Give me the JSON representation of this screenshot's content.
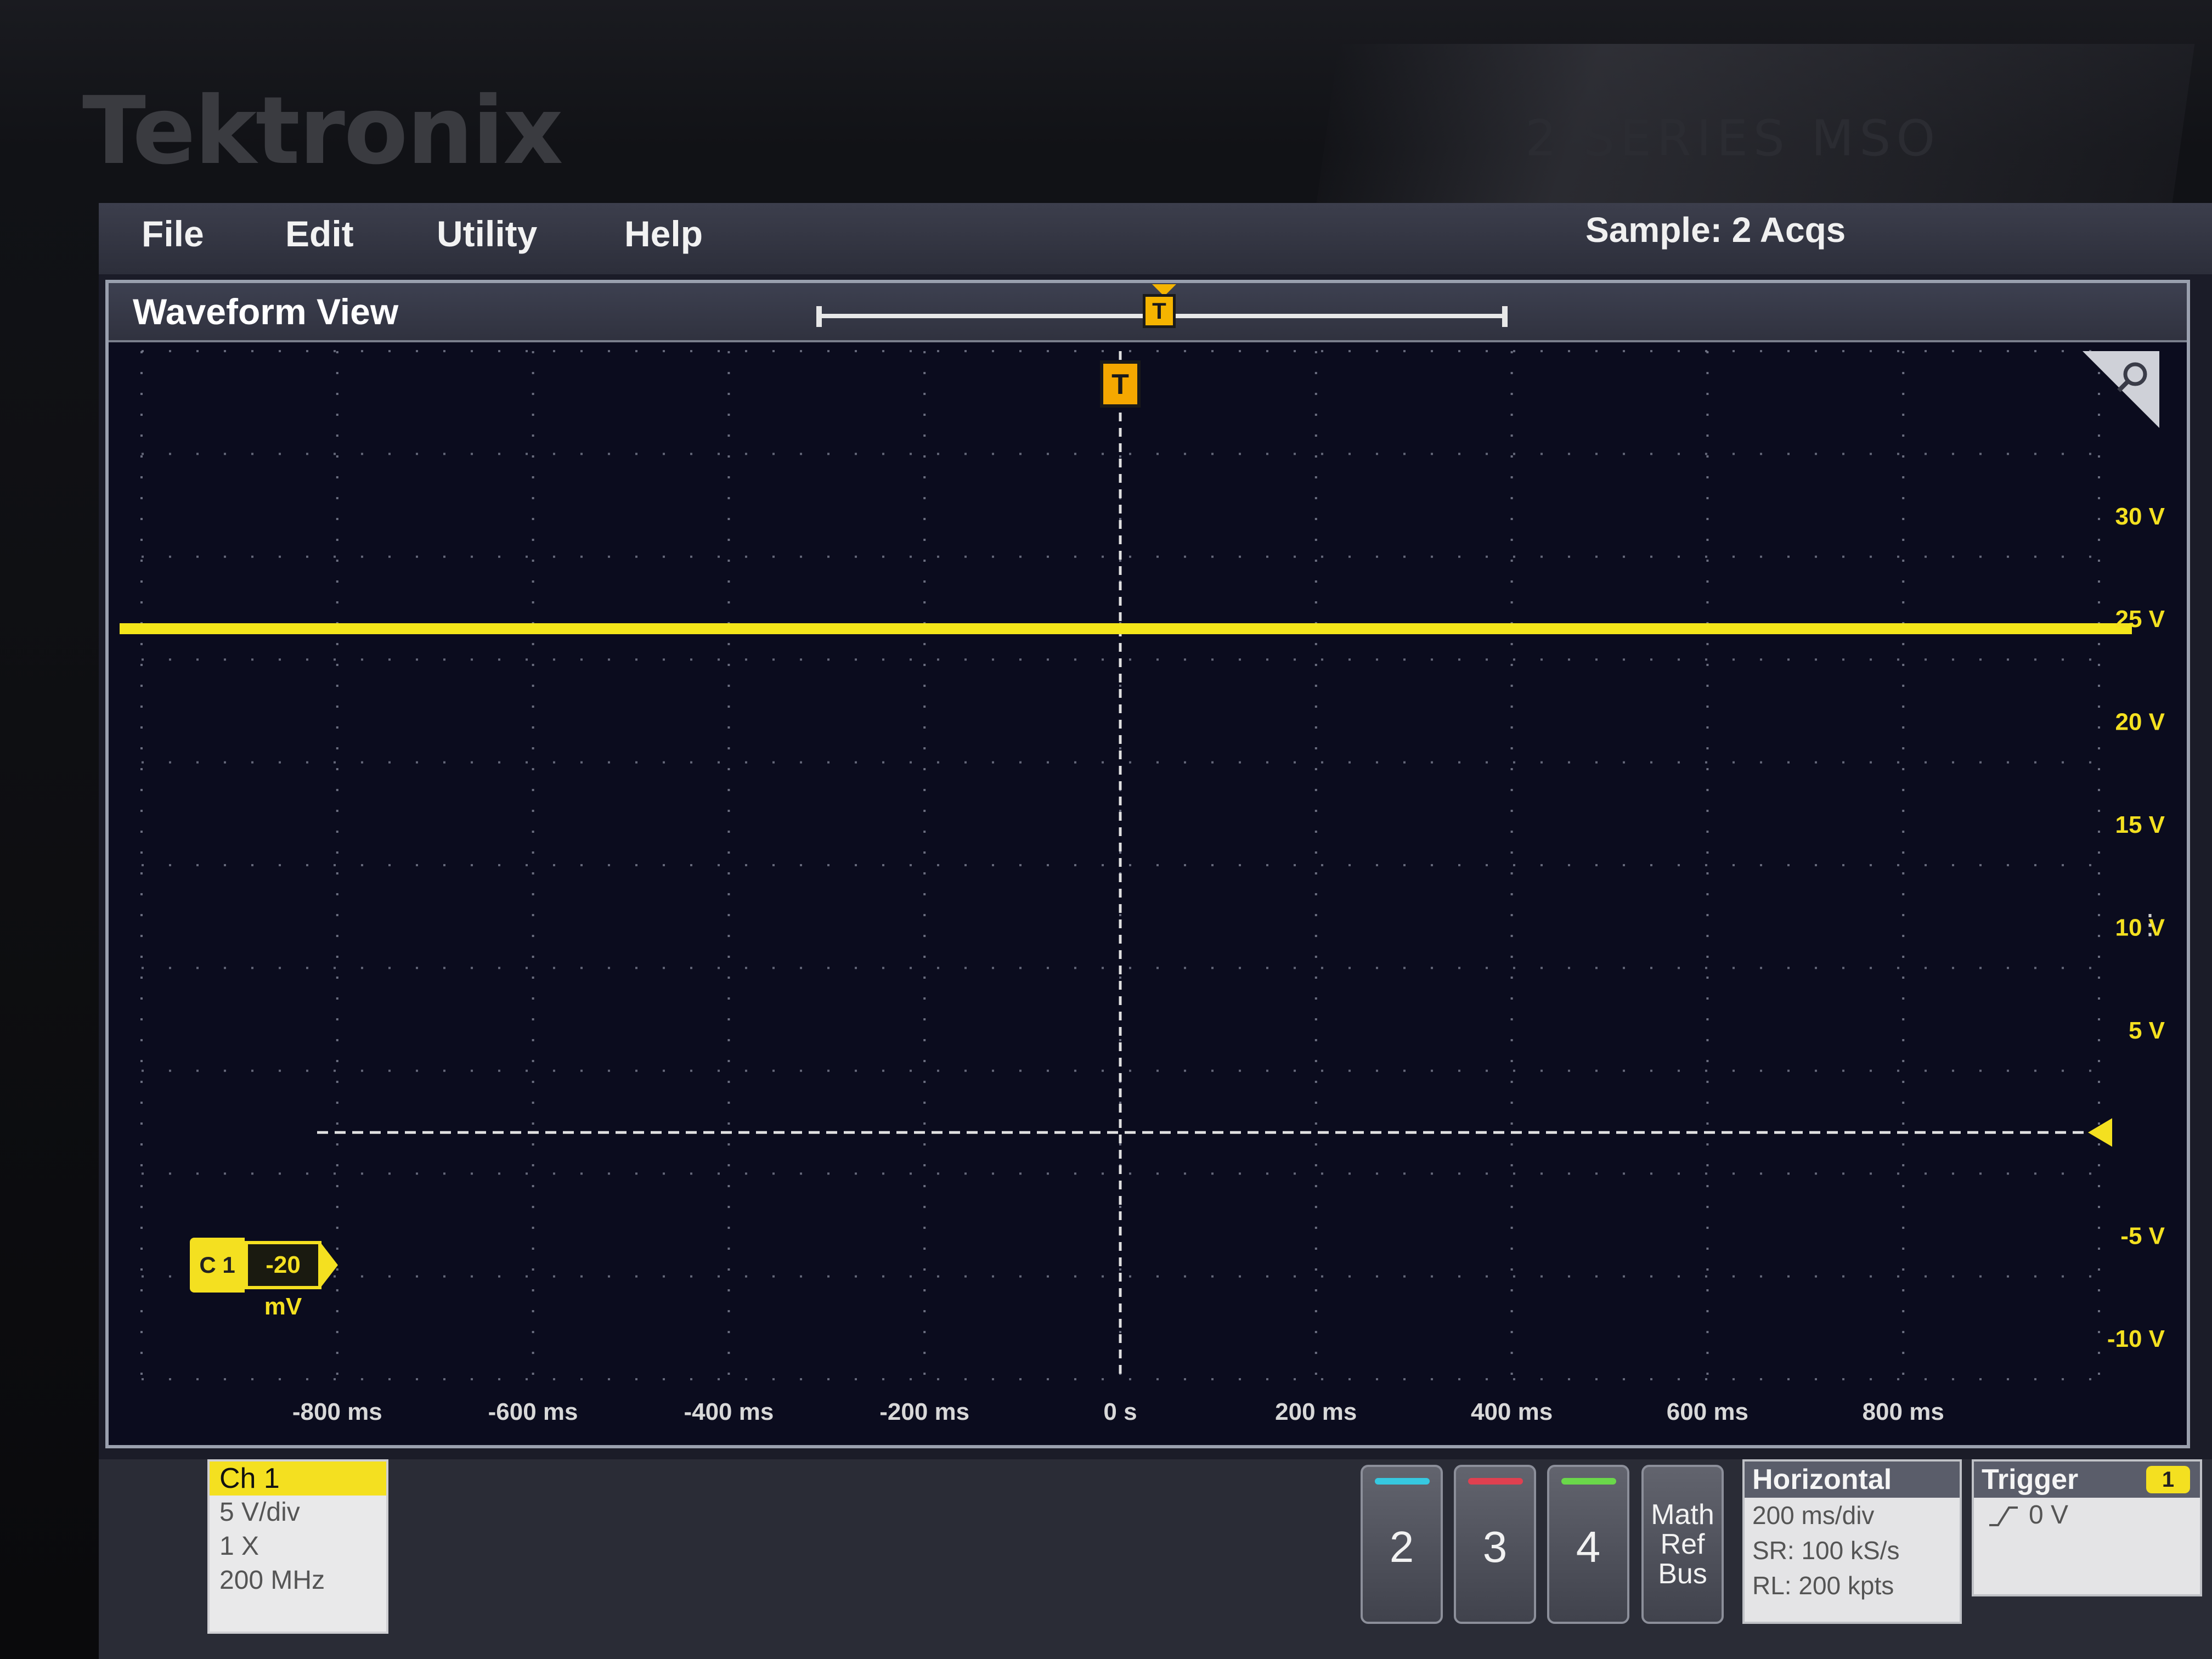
{
  "device": {
    "brand": "Tektronix",
    "series": "2 SERIES  MSO"
  },
  "menu": {
    "items": [
      "File",
      "Edit",
      "Utility",
      "Help"
    ],
    "acquisition_status": "Sample: 2 Acqs"
  },
  "waveform_view": {
    "title": "Waveform View",
    "trigger_marker": "T",
    "y_labels": [
      "30 V",
      "25 V",
      "20 V",
      "15 V",
      "10 V",
      "5 V",
      "-5 V",
      "-10 V"
    ],
    "x_labels": [
      "-800 ms",
      "-600 ms",
      "-400 ms",
      "-200 ms",
      "0 s",
      "200 ms",
      "400 ms",
      "600 ms",
      "800 ms"
    ],
    "trace_level_v": 24.5,
    "trace_color": "#f4e61a",
    "channel_marker": {
      "label": "C 1",
      "offset": "-20 mV"
    }
  },
  "badges": {
    "ch1": {
      "title": "Ch 1",
      "scale": "5 V/div",
      "probe": "1 X",
      "bandwidth": "200 MHz",
      "color": "#f4e020"
    },
    "channel_buttons": [
      {
        "label": "2",
        "color": "#36c8e0"
      },
      {
        "label": "3",
        "color": "#e04050"
      },
      {
        "label": "4",
        "color": "#6ad84a"
      }
    ],
    "math_ref_bus": [
      "Math",
      "Ref",
      "Bus"
    ],
    "horizontal": {
      "title": "Horizontal",
      "scale": "200 ms/div",
      "sample_rate": "SR: 100 kS/s",
      "record_length": "RL: 200 kpts"
    },
    "trigger": {
      "title": "Trigger",
      "source": "1",
      "level": "0 V"
    }
  }
}
